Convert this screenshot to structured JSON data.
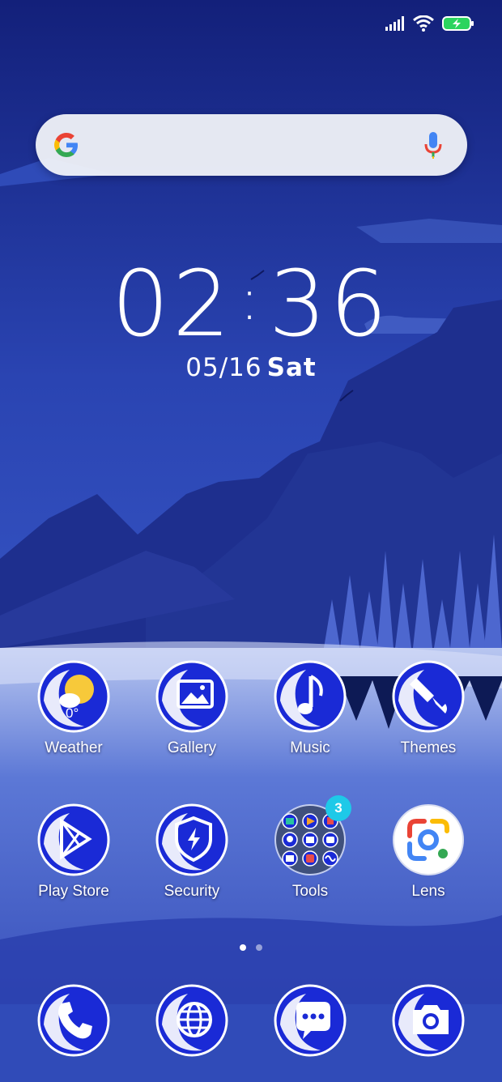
{
  "clock": {
    "hours": "02",
    "separator": ":",
    "minutes": "36"
  },
  "date": {
    "date": "05/16",
    "weekday": "Sat"
  },
  "weather_temp": "0°",
  "apps_row1": [
    {
      "label": "Weather",
      "icon": "weather-icon"
    },
    {
      "label": "Gallery",
      "icon": "gallery-icon"
    },
    {
      "label": "Music",
      "icon": "music-icon"
    },
    {
      "label": "Themes",
      "icon": "themes-icon"
    }
  ],
  "apps_row2": [
    {
      "label": "Play Store",
      "icon": "play-store-icon"
    },
    {
      "label": "Security",
      "icon": "security-icon"
    },
    {
      "label": "Tools",
      "icon": "tools-folder-icon",
      "badge": "3"
    },
    {
      "label": "Lens",
      "icon": "lens-icon"
    }
  ],
  "dock": [
    {
      "icon": "phone-icon"
    },
    {
      "icon": "browser-icon"
    },
    {
      "icon": "messages-icon"
    },
    {
      "icon": "camera-icon"
    }
  ],
  "colors": {
    "icon_blue": "#1a2ad6",
    "badge": "#1ec9e8",
    "sky": "#2b45b5"
  }
}
